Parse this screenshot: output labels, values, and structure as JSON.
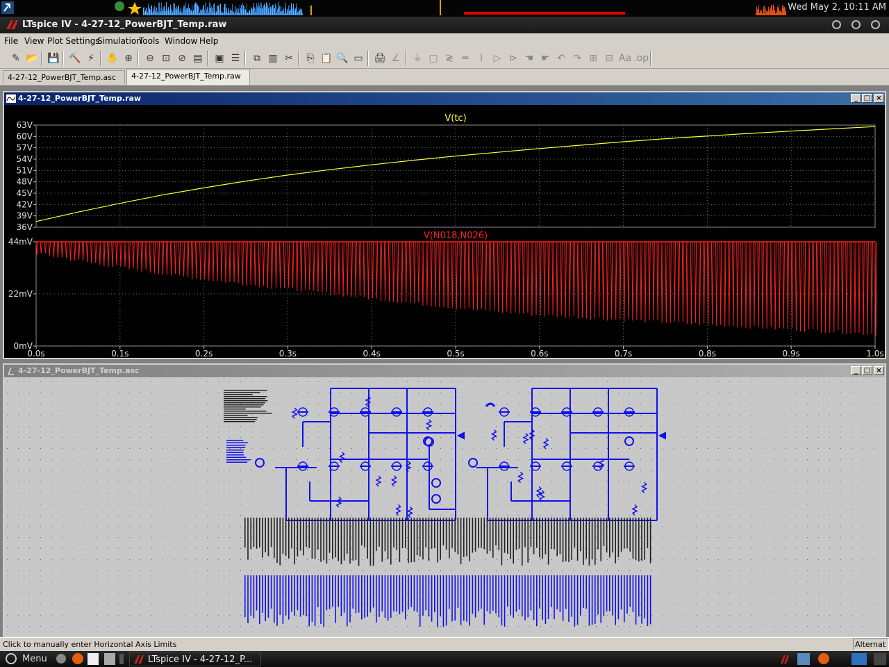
{
  "system_panel": {
    "clock": "Wed May  2, 10:11 AM"
  },
  "window": {
    "title": "LTspice IV - 4-27-12_PowerBJT_Temp.raw",
    "controls": [
      "minimize",
      "maximize",
      "close"
    ]
  },
  "menu": {
    "items": [
      "File",
      "View",
      "Plot Settings",
      "Simulation",
      "Tools",
      "Window",
      "Help"
    ]
  },
  "toolbar": {
    "icons": [
      "new-schematic-icon",
      "open-icon",
      "save-icon",
      "control-panel-icon",
      "run-icon",
      "halt-icon",
      "zoom-in-icon",
      "zoom-out-icon",
      "zoom-fit-icon",
      "zoom-cancel-icon",
      "autorange-icon",
      "pick-visible-traces-icon",
      "tile-horizontal-icon",
      "cascade-icon",
      "tile-vertical-icon",
      "cut-icon",
      "copy-icon",
      "paste-icon",
      "find-icon",
      "print-preview-icon",
      "print-icon",
      "wire-icon",
      "ground-icon",
      "label-net-icon",
      "resistor-icon",
      "capacitor-icon",
      "inductor-icon",
      "diode-icon",
      "component-icon",
      "move-icon",
      "drag-icon",
      "undo-icon",
      "redo-icon",
      "rotate-icon",
      "mirror-icon",
      "text-icon",
      "spice-directive-icon"
    ]
  },
  "tabs": [
    {
      "label": "4-27-12_PowerBJT_Temp.asc",
      "active": false
    },
    {
      "label": "4-27-12_PowerBJT_Temp.raw",
      "active": true
    }
  ],
  "waveform_window": {
    "title": "4-27-12_PowerBJT_Temp.raw"
  },
  "schematic_window": {
    "title": "4-27-12_PowerBJT_Temp.asc"
  },
  "status": {
    "message": "Click to manually enter Horizontal Axis Limits",
    "mode": "Alternat"
  },
  "taskbar": {
    "menu_label": "Menu",
    "task_label": "LTspice IV - 4-27-12_P..."
  },
  "colors": {
    "trace_tc": "#ffff33",
    "trace_n018": "#ff2020",
    "plot_bg": "#000000",
    "schematic_wire": "#1010ee",
    "schematic_bg": "#c8c8c8"
  },
  "chart_data": [
    {
      "type": "line",
      "series": [
        {
          "name": "V(tc)",
          "x": [
            0,
            0.05,
            0.1,
            0.15,
            0.2,
            0.25,
            0.3,
            0.35,
            0.4,
            0.45,
            0.5,
            0.55,
            0.6,
            0.65,
            0.7,
            0.75,
            0.8,
            0.85,
            0.9,
            0.95,
            1.0
          ],
          "values": [
            37.5,
            40.0,
            42.3,
            44.5,
            46.4,
            48.2,
            49.8,
            51.2,
            52.5,
            53.7,
            54.8,
            55.8,
            56.8,
            57.7,
            58.6,
            59.4,
            60.1,
            60.8,
            61.4,
            62.0,
            62.6
          ]
        }
      ],
      "xlim": [
        0,
        1.0
      ],
      "ylim": [
        36,
        63
      ],
      "yticks": [
        "63V",
        "60V",
        "57V",
        "54V",
        "51V",
        "48V",
        "45V",
        "42V",
        "39V",
        "36V"
      ],
      "ytick_values": [
        63,
        60,
        57,
        54,
        51,
        48,
        45,
        42,
        39,
        36
      ],
      "grid": true
    },
    {
      "type": "line",
      "series": [
        {
          "name": "V(N018,N026)",
          "pulse_peak_mV": 44,
          "x": [
            0,
            0.1,
            0.2,
            0.3,
            0.4,
            0.5,
            0.6,
            0.7,
            0.8,
            0.9,
            1.0
          ],
          "trough_mV": [
            39,
            33,
            28,
            24,
            20,
            16,
            13,
            11,
            9,
            7,
            5
          ]
        }
      ],
      "pulse_count": 200,
      "xlim": [
        0,
        1.0
      ],
      "ylim": [
        0,
        44
      ],
      "yticks": [
        "44mV",
        "22mV",
        "0mV"
      ],
      "ytick_values": [
        44,
        22,
        0
      ],
      "xticks": [
        "0.0s",
        "0.1s",
        "0.2s",
        "0.3s",
        "0.4s",
        "0.5s",
        "0.6s",
        "0.7s",
        "0.8s",
        "0.9s",
        "1.0s"
      ],
      "xtick_values": [
        0,
        0.1,
        0.2,
        0.3,
        0.4,
        0.5,
        0.6,
        0.7,
        0.8,
        0.9,
        1.0
      ],
      "grid": true
    }
  ]
}
